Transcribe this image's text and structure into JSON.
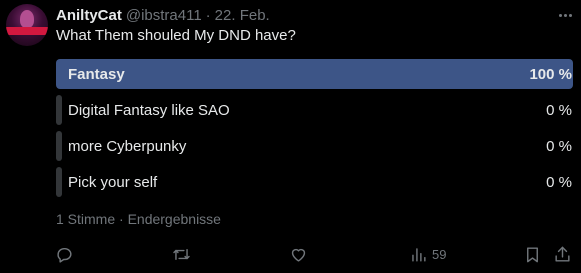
{
  "tweet": {
    "display_name": "AniltyCat",
    "handle": "@ibstra411",
    "separator": "·",
    "date": "22. Feb.",
    "question": "What Them shouled My DND have?",
    "avatar_icon": "anime-character-avatar"
  },
  "poll": {
    "options": [
      {
        "label": "Fantasy",
        "percent_text": "100 %",
        "share": 1.0,
        "winner": true
      },
      {
        "label": "Digital Fantasy like SAO",
        "percent_text": "0 %",
        "share": 0.0,
        "winner": false
      },
      {
        "label": "more Cyberpunky",
        "percent_text": "0 %",
        "share": 0.0,
        "winner": false
      },
      {
        "label": "Pick your self",
        "percent_text": "0 %",
        "share": 0.0,
        "winner": false
      }
    ],
    "meta": "1 Stimme · Endergebnisse",
    "winner_color": "#3d5587",
    "loser_color": "#333639"
  },
  "actions": {
    "reply_icon": "reply-icon",
    "retweet_icon": "retweet-icon",
    "like_icon": "like-icon",
    "views_icon": "views-icon",
    "views_count": "59",
    "bookmark_icon": "bookmark-icon",
    "share_icon": "share-icon"
  }
}
